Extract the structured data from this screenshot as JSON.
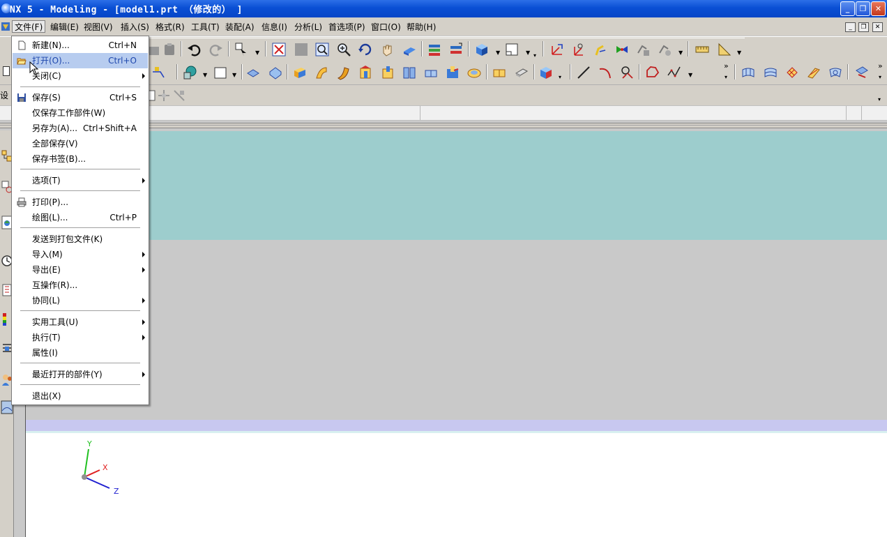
{
  "window": {
    "title": "NX 5 - Modeling - [model1.prt （修改的） ]",
    "controls": {
      "minimize": "_",
      "maximize": "❐",
      "close": "✕"
    }
  },
  "menubar": {
    "items": [
      {
        "label": "文件(F)",
        "open": true
      },
      {
        "label": "编辑(E)"
      },
      {
        "label": "视图(V)"
      },
      {
        "label": "插入(S)"
      },
      {
        "label": "格式(R)"
      },
      {
        "label": "工具(T)"
      },
      {
        "label": "装配(A)"
      },
      {
        "label": "信息(I)"
      },
      {
        "label": "分析(L)"
      },
      {
        "label": "首选项(P)"
      },
      {
        "label": "窗口(O)"
      },
      {
        "label": "帮助(H)"
      }
    ],
    "mdi_controls": {
      "minimize": "_",
      "restore": "❐",
      "close": "✕"
    }
  },
  "file_menu": {
    "items": [
      {
        "label": "新建(N)...",
        "shortcut": "Ctrl+N",
        "icon": "new-file-icon"
      },
      {
        "label": "打开(O)...",
        "shortcut": "Ctrl+O",
        "icon": "open-folder-icon",
        "highlighted": true
      },
      {
        "label": "关闭(C)",
        "submenu": true
      },
      {
        "separator": true
      },
      {
        "label": "保存(S)",
        "shortcut": "Ctrl+S",
        "icon": "save-disk-icon"
      },
      {
        "label": "仅保存工作部件(W)"
      },
      {
        "label": "另存为(A)...",
        "shortcut": "Ctrl+Shift+A"
      },
      {
        "label": "全部保存(V)"
      },
      {
        "label": "保存书签(B)..."
      },
      {
        "separator": true
      },
      {
        "label": "选项(T)",
        "submenu": true
      },
      {
        "separator": true
      },
      {
        "label": "打印(P)...",
        "icon": "printer-icon"
      },
      {
        "label": "绘图(L)...",
        "shortcut": "Ctrl+P"
      },
      {
        "separator": true
      },
      {
        "label": "发送到打包文件(K)"
      },
      {
        "label": "导入(M)",
        "submenu": true
      },
      {
        "label": "导出(E)",
        "submenu": true
      },
      {
        "label": "互操作(R)..."
      },
      {
        "label": "协同(L)",
        "submenu": true
      },
      {
        "separator": true
      },
      {
        "label": "实用工具(U)",
        "submenu": true
      },
      {
        "label": "执行(T)",
        "submenu": true
      },
      {
        "label": "属性(I)"
      },
      {
        "separator": true
      },
      {
        "label": "最近打开的部件(Y)",
        "submenu": true
      },
      {
        "separator": true
      },
      {
        "label": "退出(X)"
      }
    ]
  },
  "toolbar_left_label": "设",
  "toolbar_overflow": "»",
  "colors": {
    "titlebar": "#0a4fd4",
    "chrome": "#d4d0c8",
    "viewport_teal": "#9dcdcd",
    "viewport_gray": "#c9c9c9",
    "menu_highlight": "#b7ccef"
  },
  "triad": {
    "x": "X",
    "y": "Y",
    "z": "Z"
  }
}
